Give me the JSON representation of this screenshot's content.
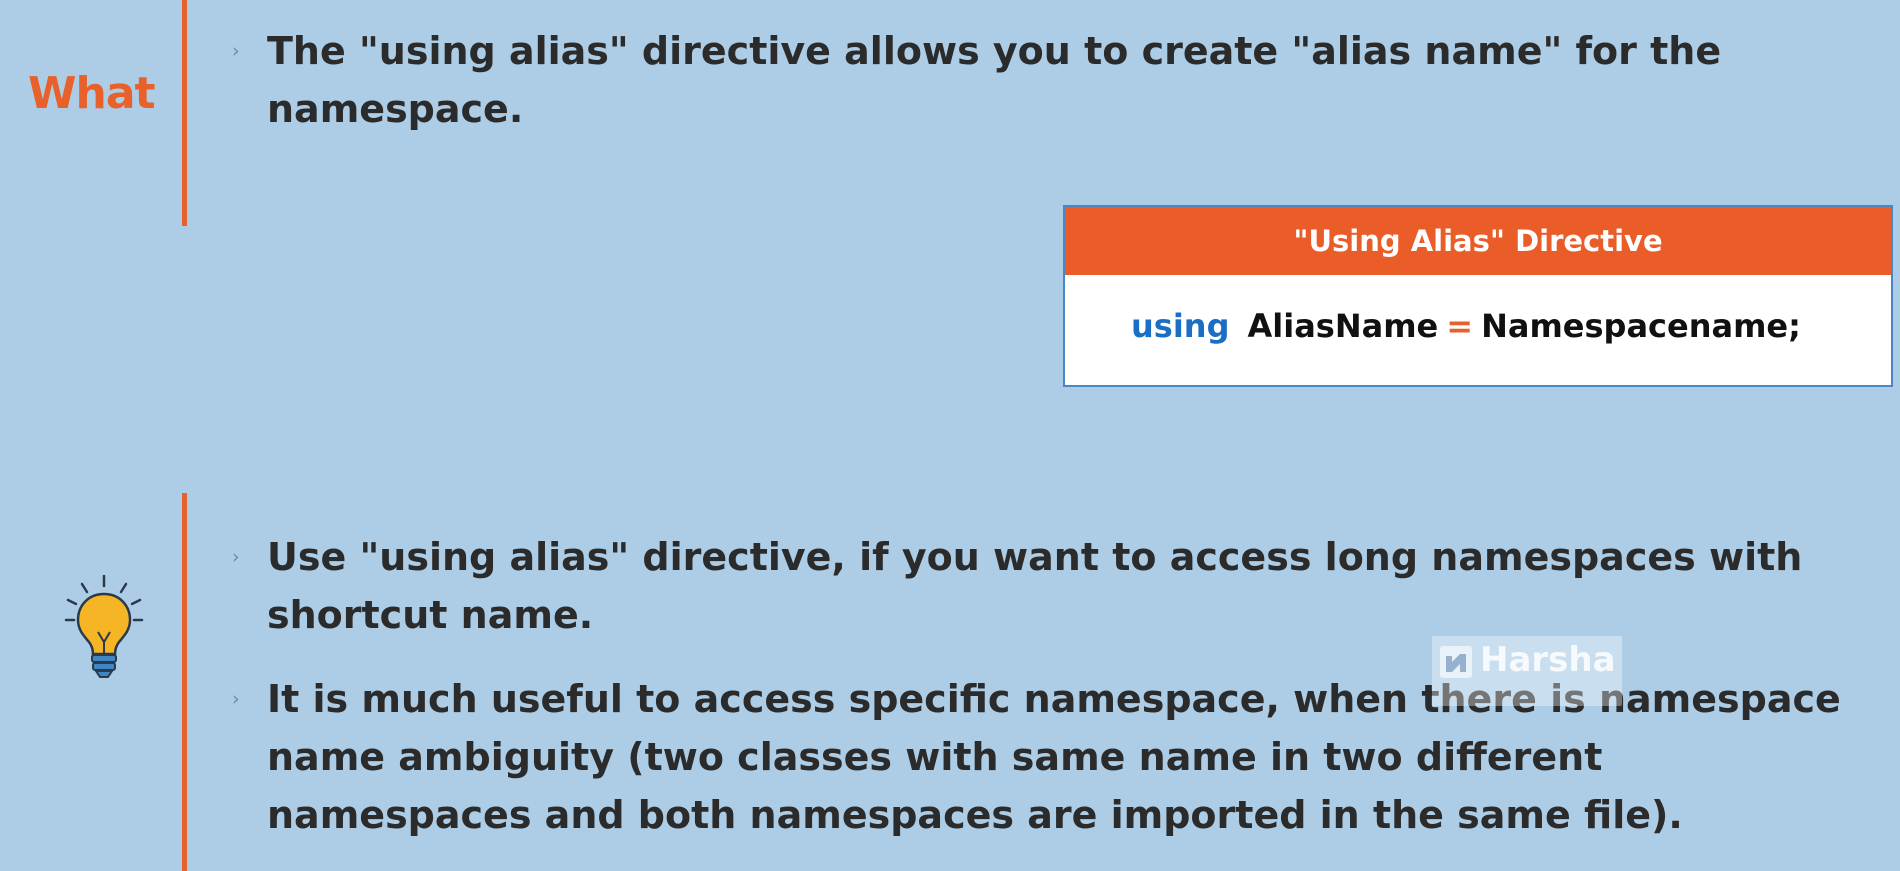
{
  "what_section": {
    "label": "What",
    "text": "The \"using alias\" directive allows you to create \"alias name\" for the namespace."
  },
  "syntax_box": {
    "title": "\"Using Alias\" Directive",
    "keyword": "using",
    "alias": "AliasName",
    "operator": "=",
    "target": "Namespacename;"
  },
  "tips": {
    "items": [
      "Use \"using alias\" directive, if you want to access long namespaces with shortcut name.",
      "It is much useful to access specific namespace, when there is namespace name ambiguity (two classes with same name in two different namespaces and both namespaces are imported in the same file)."
    ]
  },
  "watermark": {
    "text": "Harsha"
  },
  "colors": {
    "background": "#adcde6",
    "accent": "#e8602a",
    "keyword": "#1a6fc4"
  },
  "icons": {
    "tip": "lightbulb-icon",
    "bullet": "chevron-right-icon"
  }
}
